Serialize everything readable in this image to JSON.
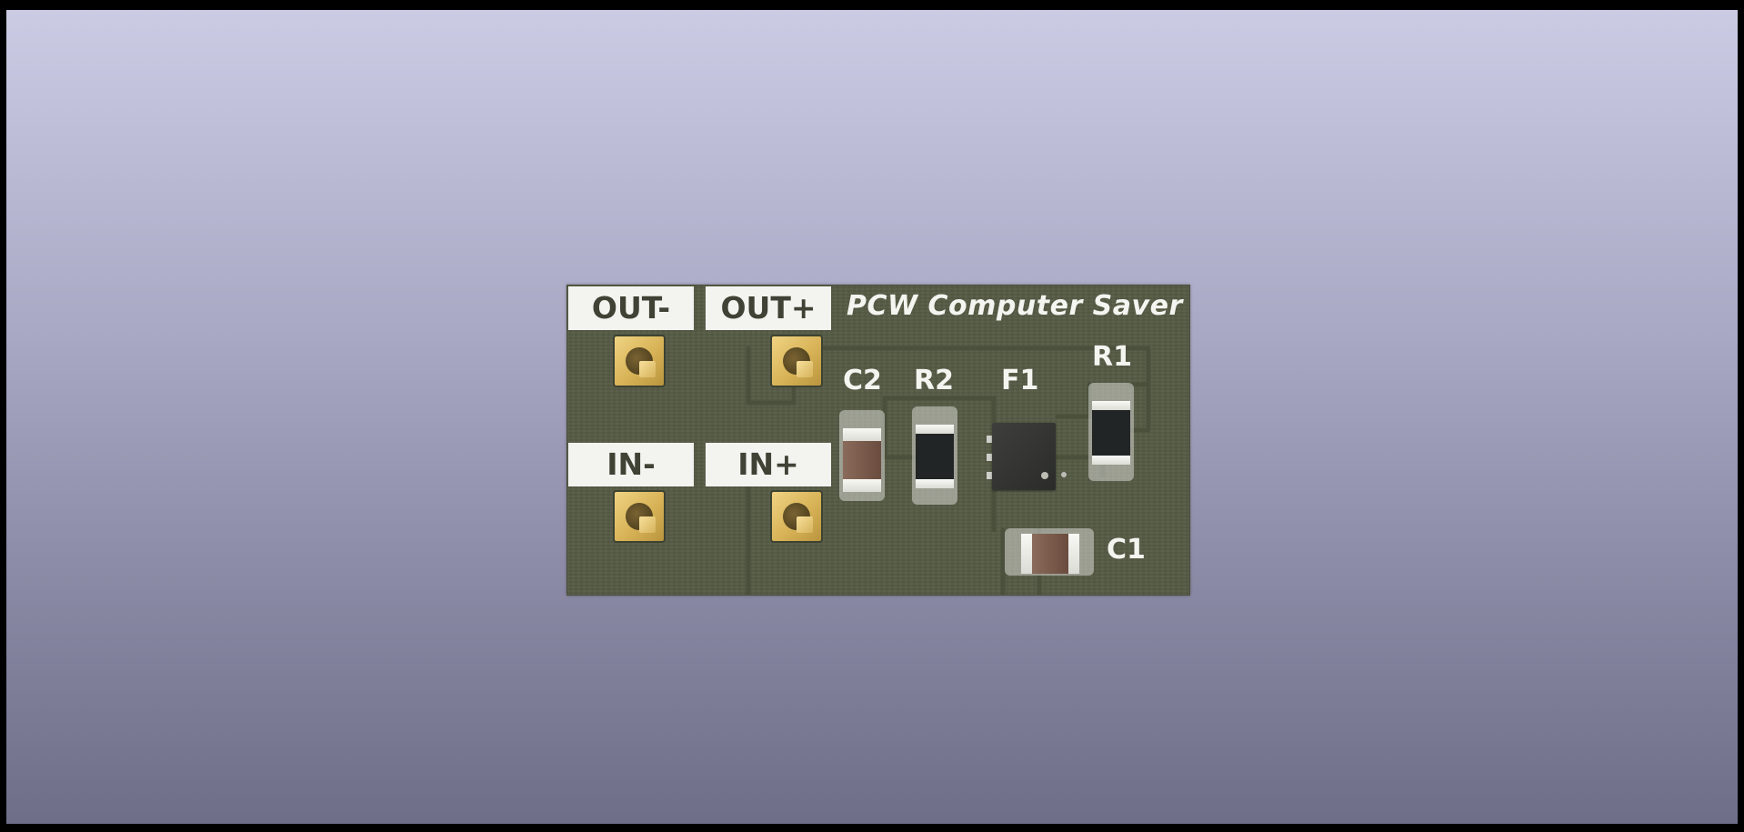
{
  "board": {
    "title": "PCW Computer Saver",
    "connectors": [
      {
        "label": "OUT-"
      },
      {
        "label": "OUT+"
      },
      {
        "label": "IN-"
      },
      {
        "label": "IN+"
      }
    ],
    "components": [
      {
        "ref": "C2",
        "kind": "capacitor"
      },
      {
        "ref": "R2",
        "kind": "resistor"
      },
      {
        "ref": "F1",
        "kind": "fuse"
      },
      {
        "ref": "R1",
        "kind": "resistor"
      },
      {
        "ref": "C1",
        "kind": "capacitor"
      }
    ]
  },
  "colors": {
    "background_top": "#cbcbe4",
    "background_bottom": "#6e6e88",
    "pcb": "#555a44",
    "silkscreen": "#f4f4f0",
    "pad_gold": "#d8b357",
    "capacitor": "#7a5b4c",
    "resistor": "#222526",
    "fuse": "#2f302d"
  }
}
